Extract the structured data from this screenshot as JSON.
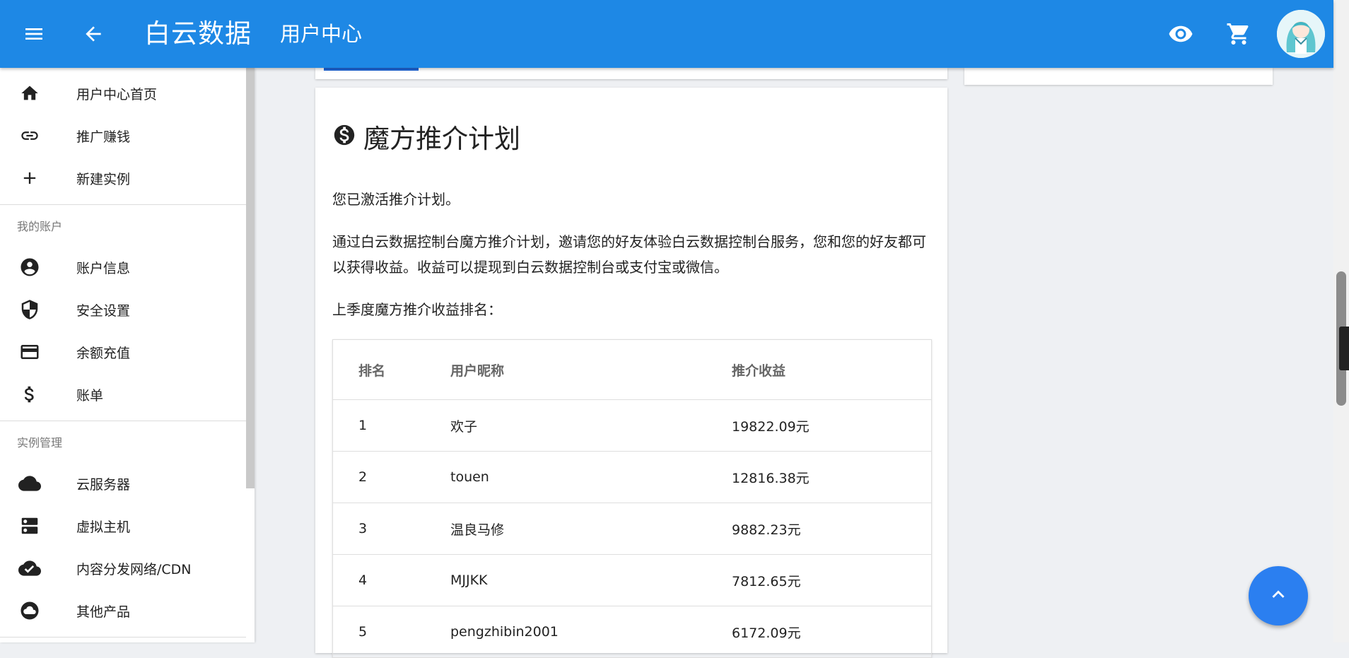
{
  "appbar": {
    "brand": "白云数据",
    "page_title": "用户中心",
    "icons": [
      "menu-icon",
      "arrow-back-icon",
      "eye-icon",
      "cart-icon"
    ],
    "color": "#1e88e5"
  },
  "sidebar": {
    "items_top": [
      {
        "label": "用户中心首页",
        "icon": "home-icon"
      },
      {
        "label": "推广赚钱",
        "icon": "link-icon"
      },
      {
        "label": "新建实例",
        "icon": "plus-icon"
      }
    ],
    "account_header": "我的账户",
    "account_items": [
      {
        "label": "账户信息",
        "icon": "account-circle-icon"
      },
      {
        "label": "安全设置",
        "icon": "shield-icon"
      },
      {
        "label": "余额充值",
        "icon": "credit-card-icon"
      },
      {
        "label": "账单",
        "icon": "dollar-icon"
      }
    ],
    "instances_header": "实例管理",
    "instance_items": [
      {
        "label": "云服务器",
        "icon": "cloud-icon"
      },
      {
        "label": "虚拟主机",
        "icon": "server-icon"
      },
      {
        "label": "内容分发网络/CDN",
        "icon": "cloud-check-icon"
      },
      {
        "label": "其他产品",
        "icon": "cloud-outline-icon"
      }
    ]
  },
  "card": {
    "title": "魔方推介计划",
    "title_icon": "monetization-icon",
    "status": "您已激活推介计划。",
    "description": "通过白云数据控制台魔方推介计划，邀请您的好友体验白云数据控制台服务，您和您的好友都可以获得收益。收益可以提现到白云数据控制台或支付宝或微信。",
    "ranking_intro": "上季度魔方推介收益排名：",
    "table": {
      "headers": [
        "排名",
        "用户昵称",
        "推介收益"
      ],
      "rows": [
        [
          "1",
          "欢子",
          "19822.09元"
        ],
        [
          "2",
          "touen",
          "12816.38元"
        ],
        [
          "3",
          "温良马修",
          "9882.23元"
        ],
        [
          "4",
          "MJJKK",
          "7812.65元"
        ],
        [
          "5",
          "pengzhibin2001",
          "6172.09元"
        ]
      ]
    }
  },
  "fab": {
    "icon": "chevron-up-icon",
    "color": "#2b7ff0"
  }
}
